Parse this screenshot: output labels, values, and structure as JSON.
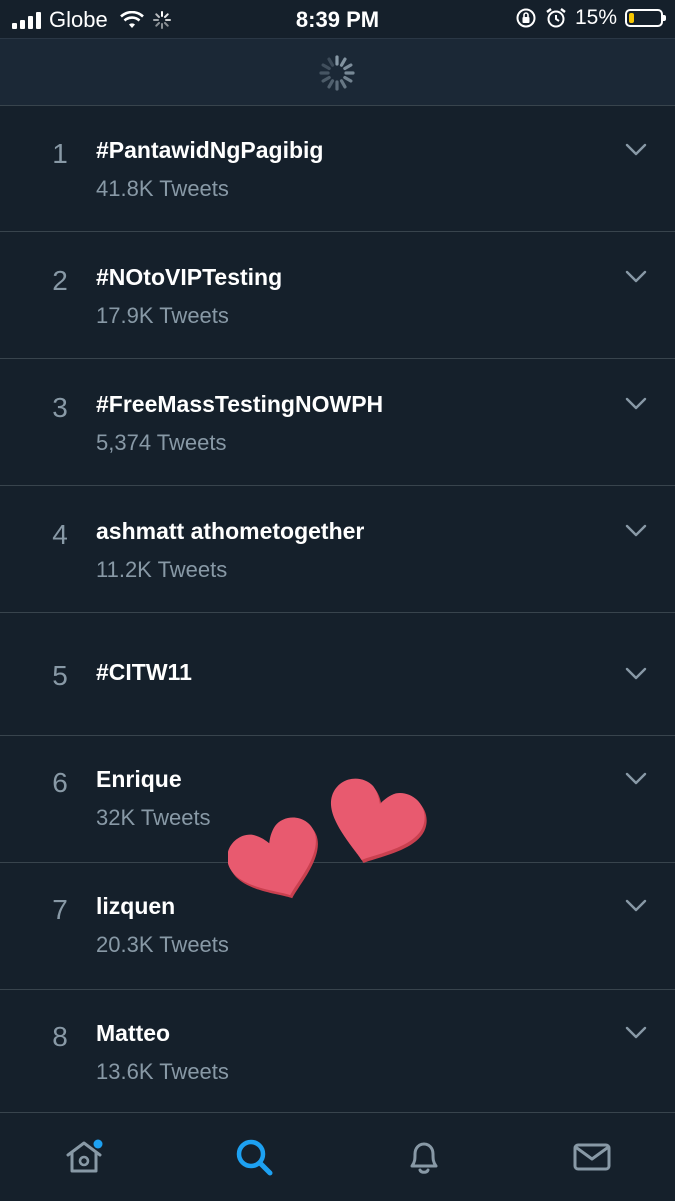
{
  "status_bar": {
    "carrier": "Globe",
    "time": "8:39 PM",
    "battery_percent": "15%",
    "battery_level": 0.15,
    "icons": [
      "signal-bars-icon",
      "wifi-icon",
      "activity-spinner-icon",
      "orientation-lock-icon",
      "alarm-clock-icon",
      "battery-icon"
    ]
  },
  "header": {
    "loading": true,
    "icon": "loading-spinner-icon"
  },
  "trends": [
    {
      "rank": "1",
      "topic": "#PantawidNgPagibig",
      "count": "41.8K Tweets"
    },
    {
      "rank": "2",
      "topic": "#NOtoVIPTesting",
      "count": "17.9K Tweets"
    },
    {
      "rank": "3",
      "topic": "#FreeMassTestingNOWPH",
      "count": "5,374 Tweets"
    },
    {
      "rank": "4",
      "topic": "ashmatt athometogether",
      "count": "11.2K Tweets"
    },
    {
      "rank": "5",
      "topic": "#CITW11",
      "count": ""
    },
    {
      "rank": "6",
      "topic": "Enrique",
      "count": "32K Tweets"
    },
    {
      "rank": "7",
      "topic": "lizquen",
      "count": "20.3K Tweets"
    },
    {
      "rank": "8",
      "topic": "Matteo",
      "count": "13.6K Tweets"
    }
  ],
  "tab_bar": {
    "tabs": [
      {
        "name": "home",
        "icon": "home-icon",
        "active": false,
        "has_notification_dot": true
      },
      {
        "name": "search",
        "icon": "search-icon",
        "active": true
      },
      {
        "name": "notifications",
        "icon": "bell-icon",
        "active": false
      },
      {
        "name": "messages",
        "icon": "envelope-icon",
        "active": false
      }
    ]
  },
  "overlay": {
    "stickers": [
      "heart-sticker",
      "heart-sticker"
    ]
  },
  "colors": {
    "background": "#15202b",
    "header_background": "#1b2836",
    "divider": "#38444d",
    "secondary_text": "#8899a6",
    "accent": "#1da1f2",
    "heart": "#e85a6f",
    "battery_low": "#f7c600"
  }
}
